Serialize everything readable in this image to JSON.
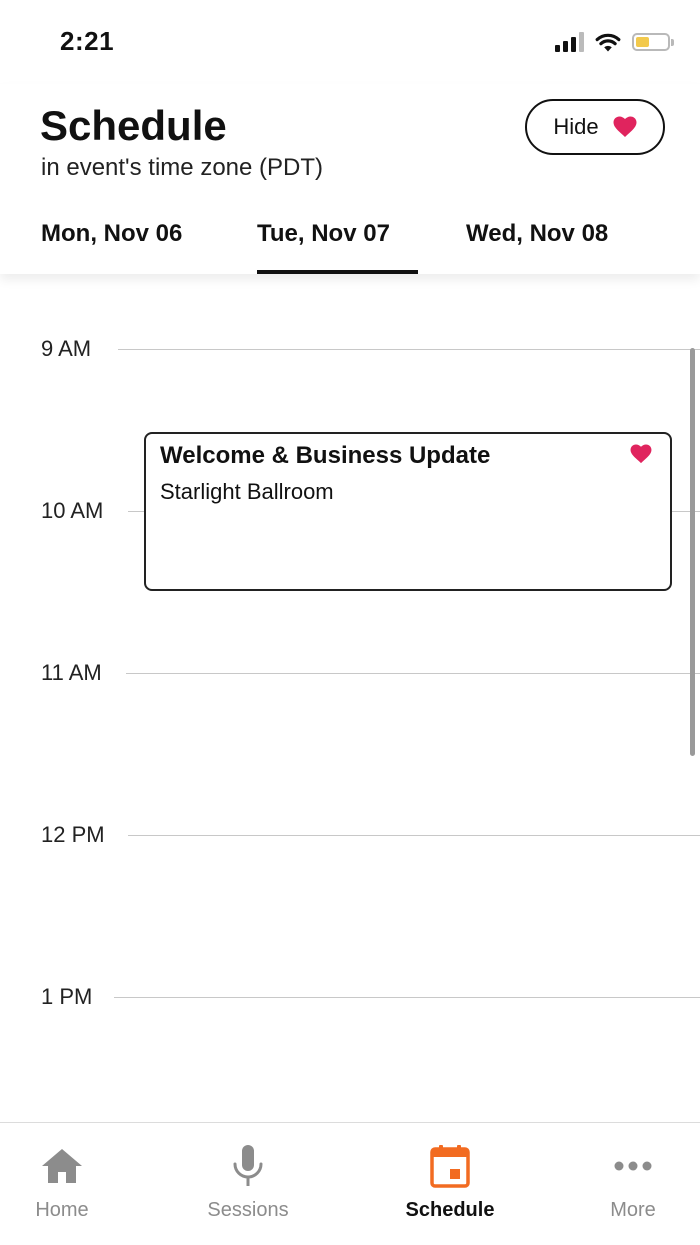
{
  "status_bar": {
    "time": "2:21"
  },
  "header": {
    "title": "Schedule",
    "subtitle": "in event's time zone (PDT)",
    "hide_label": "Hide"
  },
  "days": [
    {
      "label": "Mon, Nov 06",
      "active": false
    },
    {
      "label": "Tue, Nov 07",
      "active": true
    },
    {
      "label": "Wed, Nov 08",
      "active": false
    }
  ],
  "timeline": {
    "hours": [
      "9 AM",
      "10 AM",
      "11 AM",
      "12 PM",
      "1 PM"
    ],
    "events": [
      {
        "title": "Welcome & Business Update",
        "location": "Starlight Ballroom",
        "favorited": true,
        "icon": "heart-icon"
      }
    ]
  },
  "tab_bar": {
    "items": [
      {
        "label": "Home",
        "icon": "home-icon",
        "active": false
      },
      {
        "label": "Sessions",
        "icon": "microphone-icon",
        "active": false
      },
      {
        "label": "Schedule",
        "icon": "calendar-icon",
        "active": true
      },
      {
        "label": "More",
        "icon": "more-icon",
        "active": false
      }
    ]
  },
  "colors": {
    "accent": "#F26B21",
    "favorite": "#E0245E",
    "inactive_tab": "#8C8C8C",
    "battery": "#F2C94C"
  }
}
